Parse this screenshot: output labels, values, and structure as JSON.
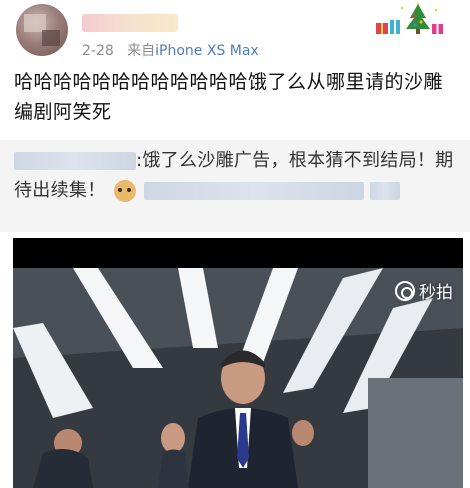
{
  "post": {
    "date": "2-28",
    "source_prefix": "来自",
    "device": "iPhone XS Max",
    "text": "哈哈哈哈哈哈哈哈哈哈哈哈饿了么从哪里请的沙雕编剧阿笑死"
  },
  "repost": {
    "text_part1": ":饿了么沙雕广告，根本猜不到结局！期待出续集！"
  },
  "video": {
    "watermark_text": "秒拍"
  },
  "colors": {
    "device_link": "#4e7cbf",
    "repost_bg": "#f4f4f4",
    "meta_gray": "#8c8c8c"
  }
}
